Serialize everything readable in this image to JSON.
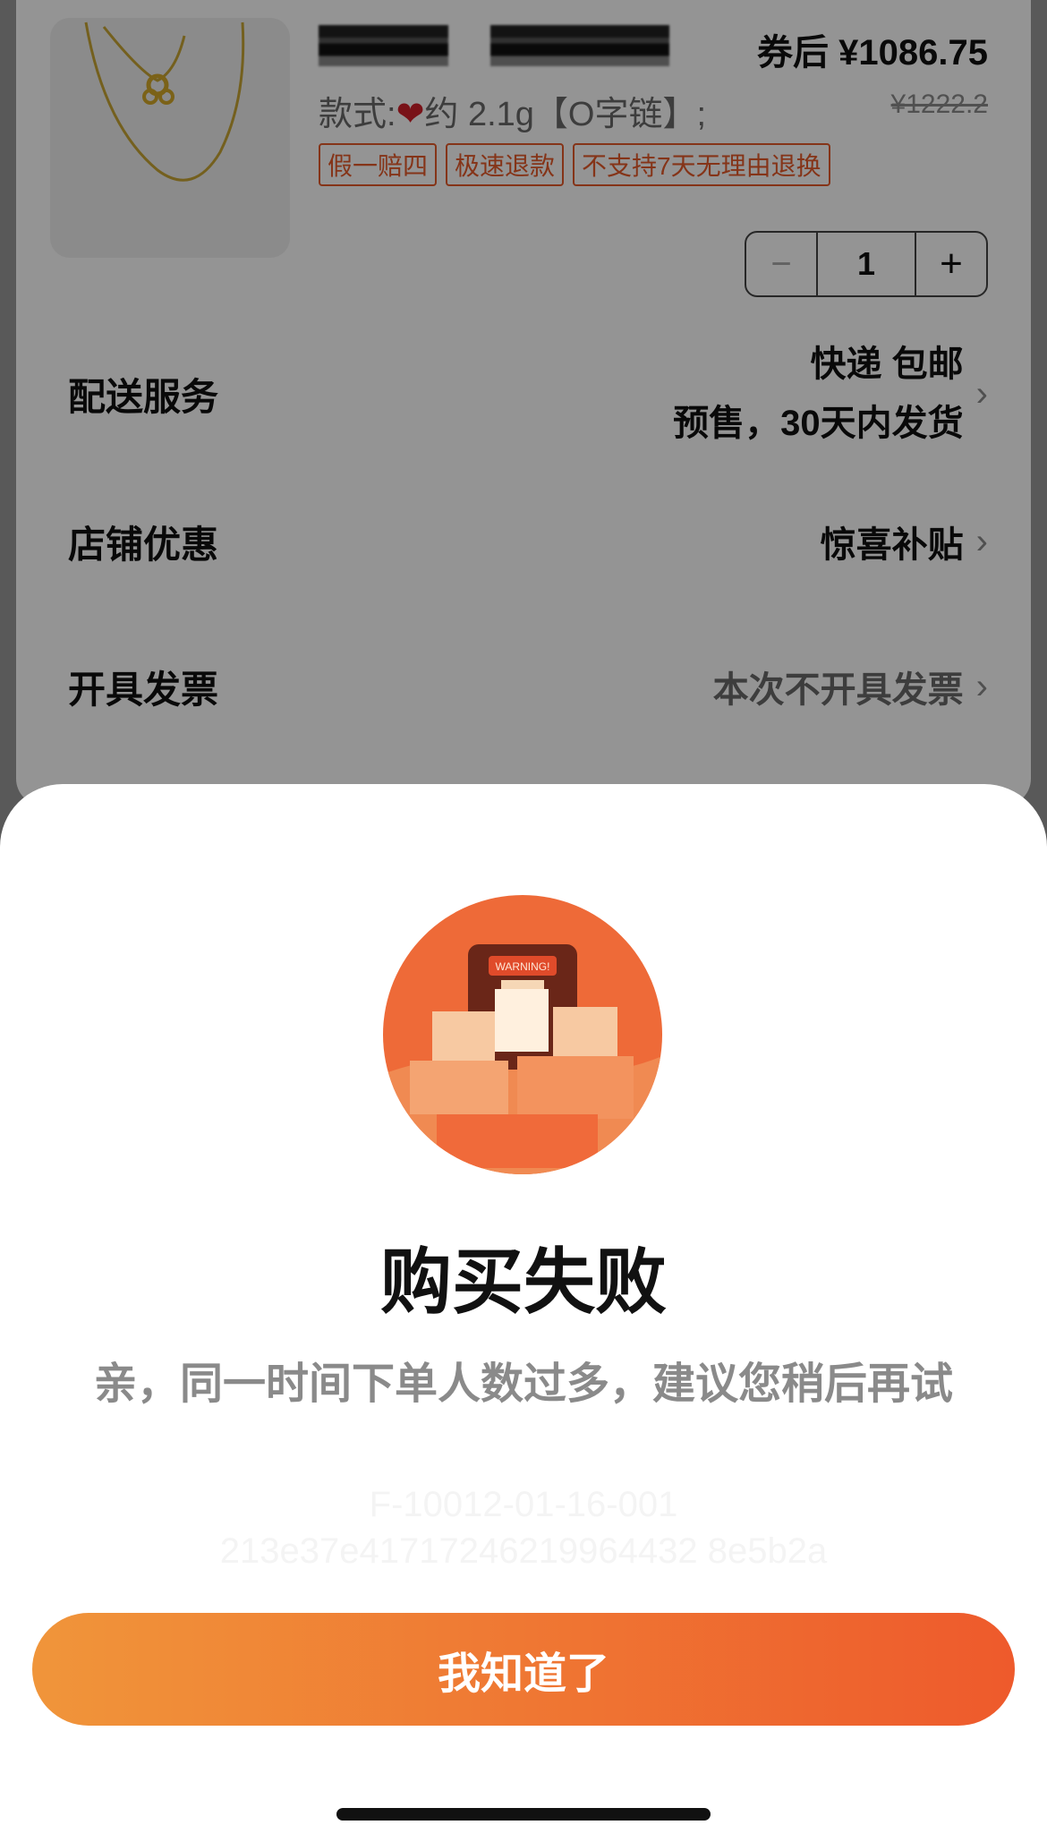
{
  "product": {
    "price_after": "券后 ¥1086.75",
    "spec_prefix": "款式:",
    "spec_suffix": "约 2.1g【O字链】;",
    "original_price": "¥1222.2",
    "tags": [
      "假一赔四",
      "极速退款",
      "不支持7天无理由退换"
    ],
    "quantity": "1",
    "minus": "−",
    "plus": "+"
  },
  "rows": {
    "delivery": {
      "label": "配送服务",
      "line1": "快递 包邮",
      "line2": "预售，30天内发货"
    },
    "discount": {
      "label": "店铺优惠",
      "value": "惊喜补贴"
    },
    "invoice": {
      "label": "开具发票",
      "value": "本次不开具发票"
    }
  },
  "dialog": {
    "illustration_text": "WARNING!",
    "title": "购买失败",
    "message": "亲，同一时间下单人数过多，建议您稍后再试",
    "error_line1": "F-10012-01-16-001",
    "error_line2": "213e37e41717246219964432 8e5b2a",
    "confirm_label": "我知道了"
  },
  "icons": {
    "chevron": "chevron-right-icon",
    "heart": "heart-icon"
  },
  "colors": {
    "accent_start": "#f0953a",
    "accent_end": "#ee5a2c",
    "tag": "#e55a2a"
  }
}
